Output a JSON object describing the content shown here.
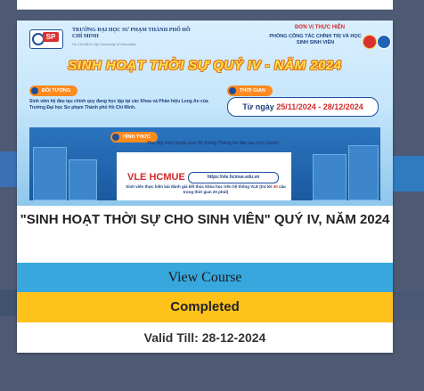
{
  "banner": {
    "university_name": "TRƯỜNG ĐẠI HỌC SƯ PHẠM THÀNH PHỐ HỒ CHÍ MINH",
    "university_subtitle": "Ho Chi Minh City University of Education",
    "logo_text": "SP",
    "organizer_label": "ĐƠN VỊ THỰC HIỆN",
    "organizer_name": "PHÒNG CÔNG TÁC CHÍNH TRỊ VÀ HỌC SINH SINH VIÊN",
    "headline": "SINH HOẠT THỜI SỰ QUÝ IV - NĂM 2024",
    "audience_tag": "ĐỐI TƯỢNG",
    "audience_text": "Sinh viên hệ đào tạo chính quy đang học tập tại các Khoa và Phân hiệu Long An của Trường Đại học Sư phạm Thành phố Hồ Chí Minh.",
    "time_tag": "THỜI GIAN",
    "time_prefix": "Từ ngày ",
    "time_range": "25/11/2024 - 28/12/2024",
    "method_tag": "HÌNH THỨC",
    "method_text": "Học tập trực tuyến qua Hệ thống Thông tin đào tạo trực tuyến",
    "vle_title": "VLE HCMUE",
    "vle_url": "https://vle.hcmue.edu.vn",
    "vle_desc_prefix": "Sinh viên thực hiện bài đánh giá kết thúc khóa học trên hệ thống VLE (trả lời ",
    "vle_desc_highlight": "30",
    "vle_desc_suffix": " câu trong thời gian 20 phút)"
  },
  "course": {
    "title": "\"SINH HOẠT THỜI SỰ CHO SINH VIÊN\" QUÝ IV, NĂM 2024",
    "view_label": "View Course",
    "status_label": "Completed",
    "valid_till": "Valid Till: 28-12-2024"
  },
  "colors": {
    "page_bg": "#4e5a73",
    "view_button": "#38a7de",
    "status_bar": "#ffc21a",
    "headline": "#ffe14a"
  }
}
